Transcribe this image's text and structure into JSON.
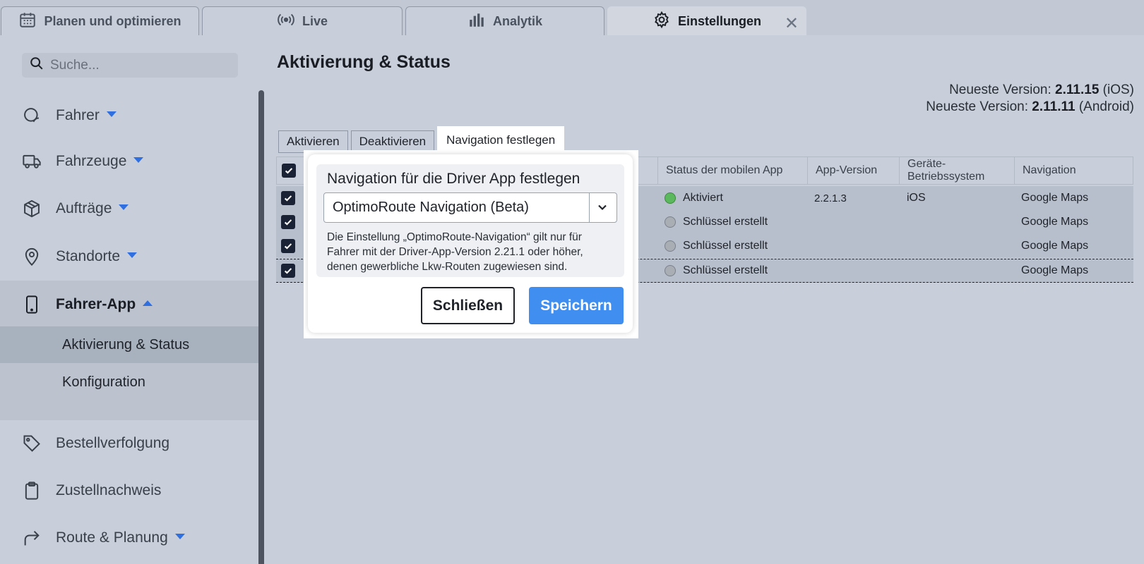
{
  "tabs": [
    {
      "label": "Planen und optimieren",
      "icon": "calendar-icon"
    },
    {
      "label": "Live",
      "icon": "broadcast-icon"
    },
    {
      "label": "Analytik",
      "icon": "bar-chart-icon"
    },
    {
      "label": "Einstellungen",
      "icon": "gear-icon",
      "active": true,
      "closable": true
    }
  ],
  "search": {
    "placeholder": "Suche..."
  },
  "sidebar": {
    "items": [
      {
        "label": "Fahrer",
        "icon": "driver-icon",
        "expandable": true
      },
      {
        "label": "Fahrzeuge",
        "icon": "truck-icon",
        "expandable": true
      },
      {
        "label": "Aufträge",
        "icon": "box-icon",
        "expandable": true
      },
      {
        "label": "Standorte",
        "icon": "location-pin-icon",
        "expandable": true
      },
      {
        "label": "Fahrer-App",
        "icon": "phone-icon",
        "expandable": true,
        "expanded": true
      },
      {
        "label": "Bestellverfolgung",
        "icon": "tag-icon"
      },
      {
        "label": "Zustellnachweis",
        "icon": "clipboard-icon"
      },
      {
        "label": "Route & Planung",
        "icon": "route-arrow-icon",
        "expandable": true
      }
    ],
    "subitems": [
      {
        "label": "Aktivierung & Status",
        "active": true
      },
      {
        "label": "Konfiguration"
      }
    ]
  },
  "page": {
    "title": "Aktivierung & Status",
    "versions": [
      {
        "prefix": "Neueste Version:",
        "version": "2.11.15",
        "platform": "(iOS)"
      },
      {
        "prefix": "Neueste Version:",
        "version": "2.11.11",
        "platform": "(Android)"
      }
    ],
    "actions": [
      {
        "label": "Aktivieren"
      },
      {
        "label": "Deaktivieren"
      },
      {
        "label": "Navigation festlegen",
        "active": true
      }
    ]
  },
  "table": {
    "columns": [
      "Status der mobilen App",
      "App-Version",
      "Geräte-Betriebssystem",
      "Navigation"
    ],
    "rows": [
      {
        "truncated": "",
        "status": "Aktiviert",
        "status_color": "#5cb85c",
        "app_version": "2.2.1.3",
        "os": "iOS",
        "navigation": "Google Maps",
        "checked": true
      },
      {
        "truncated": "...",
        "status": "Schlüssel erstellt",
        "status_color": "#a9aeb5",
        "app_version": "",
        "os": "",
        "navigation": "Google Maps",
        "checked": true
      },
      {
        "truncated": "...",
        "status": "Schlüssel erstellt",
        "status_color": "#a9aeb5",
        "app_version": "",
        "os": "",
        "navigation": "Google Maps",
        "checked": true
      },
      {
        "truncated": "...",
        "status": "Schlüssel erstellt",
        "status_color": "#a9aeb5",
        "app_version": "",
        "os": "",
        "navigation": "Google Maps",
        "checked": true
      }
    ]
  },
  "modal": {
    "title": "Navigation für die Driver App festlegen",
    "select_value": "OptimoRoute Navigation (Beta)",
    "note": "Die Einstellung „OptimoRoute-Navigation“ gilt nur für Fahrer mit der Driver-App-Version 2.21.1 oder höher, denen gewerbliche Lkw-Routen zugewiesen sind.",
    "close_label": "Schließen",
    "save_label": "Speichern"
  },
  "colors": {
    "accent": "#2f6fe0",
    "save_button": "#3f8ef0",
    "status_active": "#5cb85c",
    "status_pending": "#a9aeb5"
  }
}
